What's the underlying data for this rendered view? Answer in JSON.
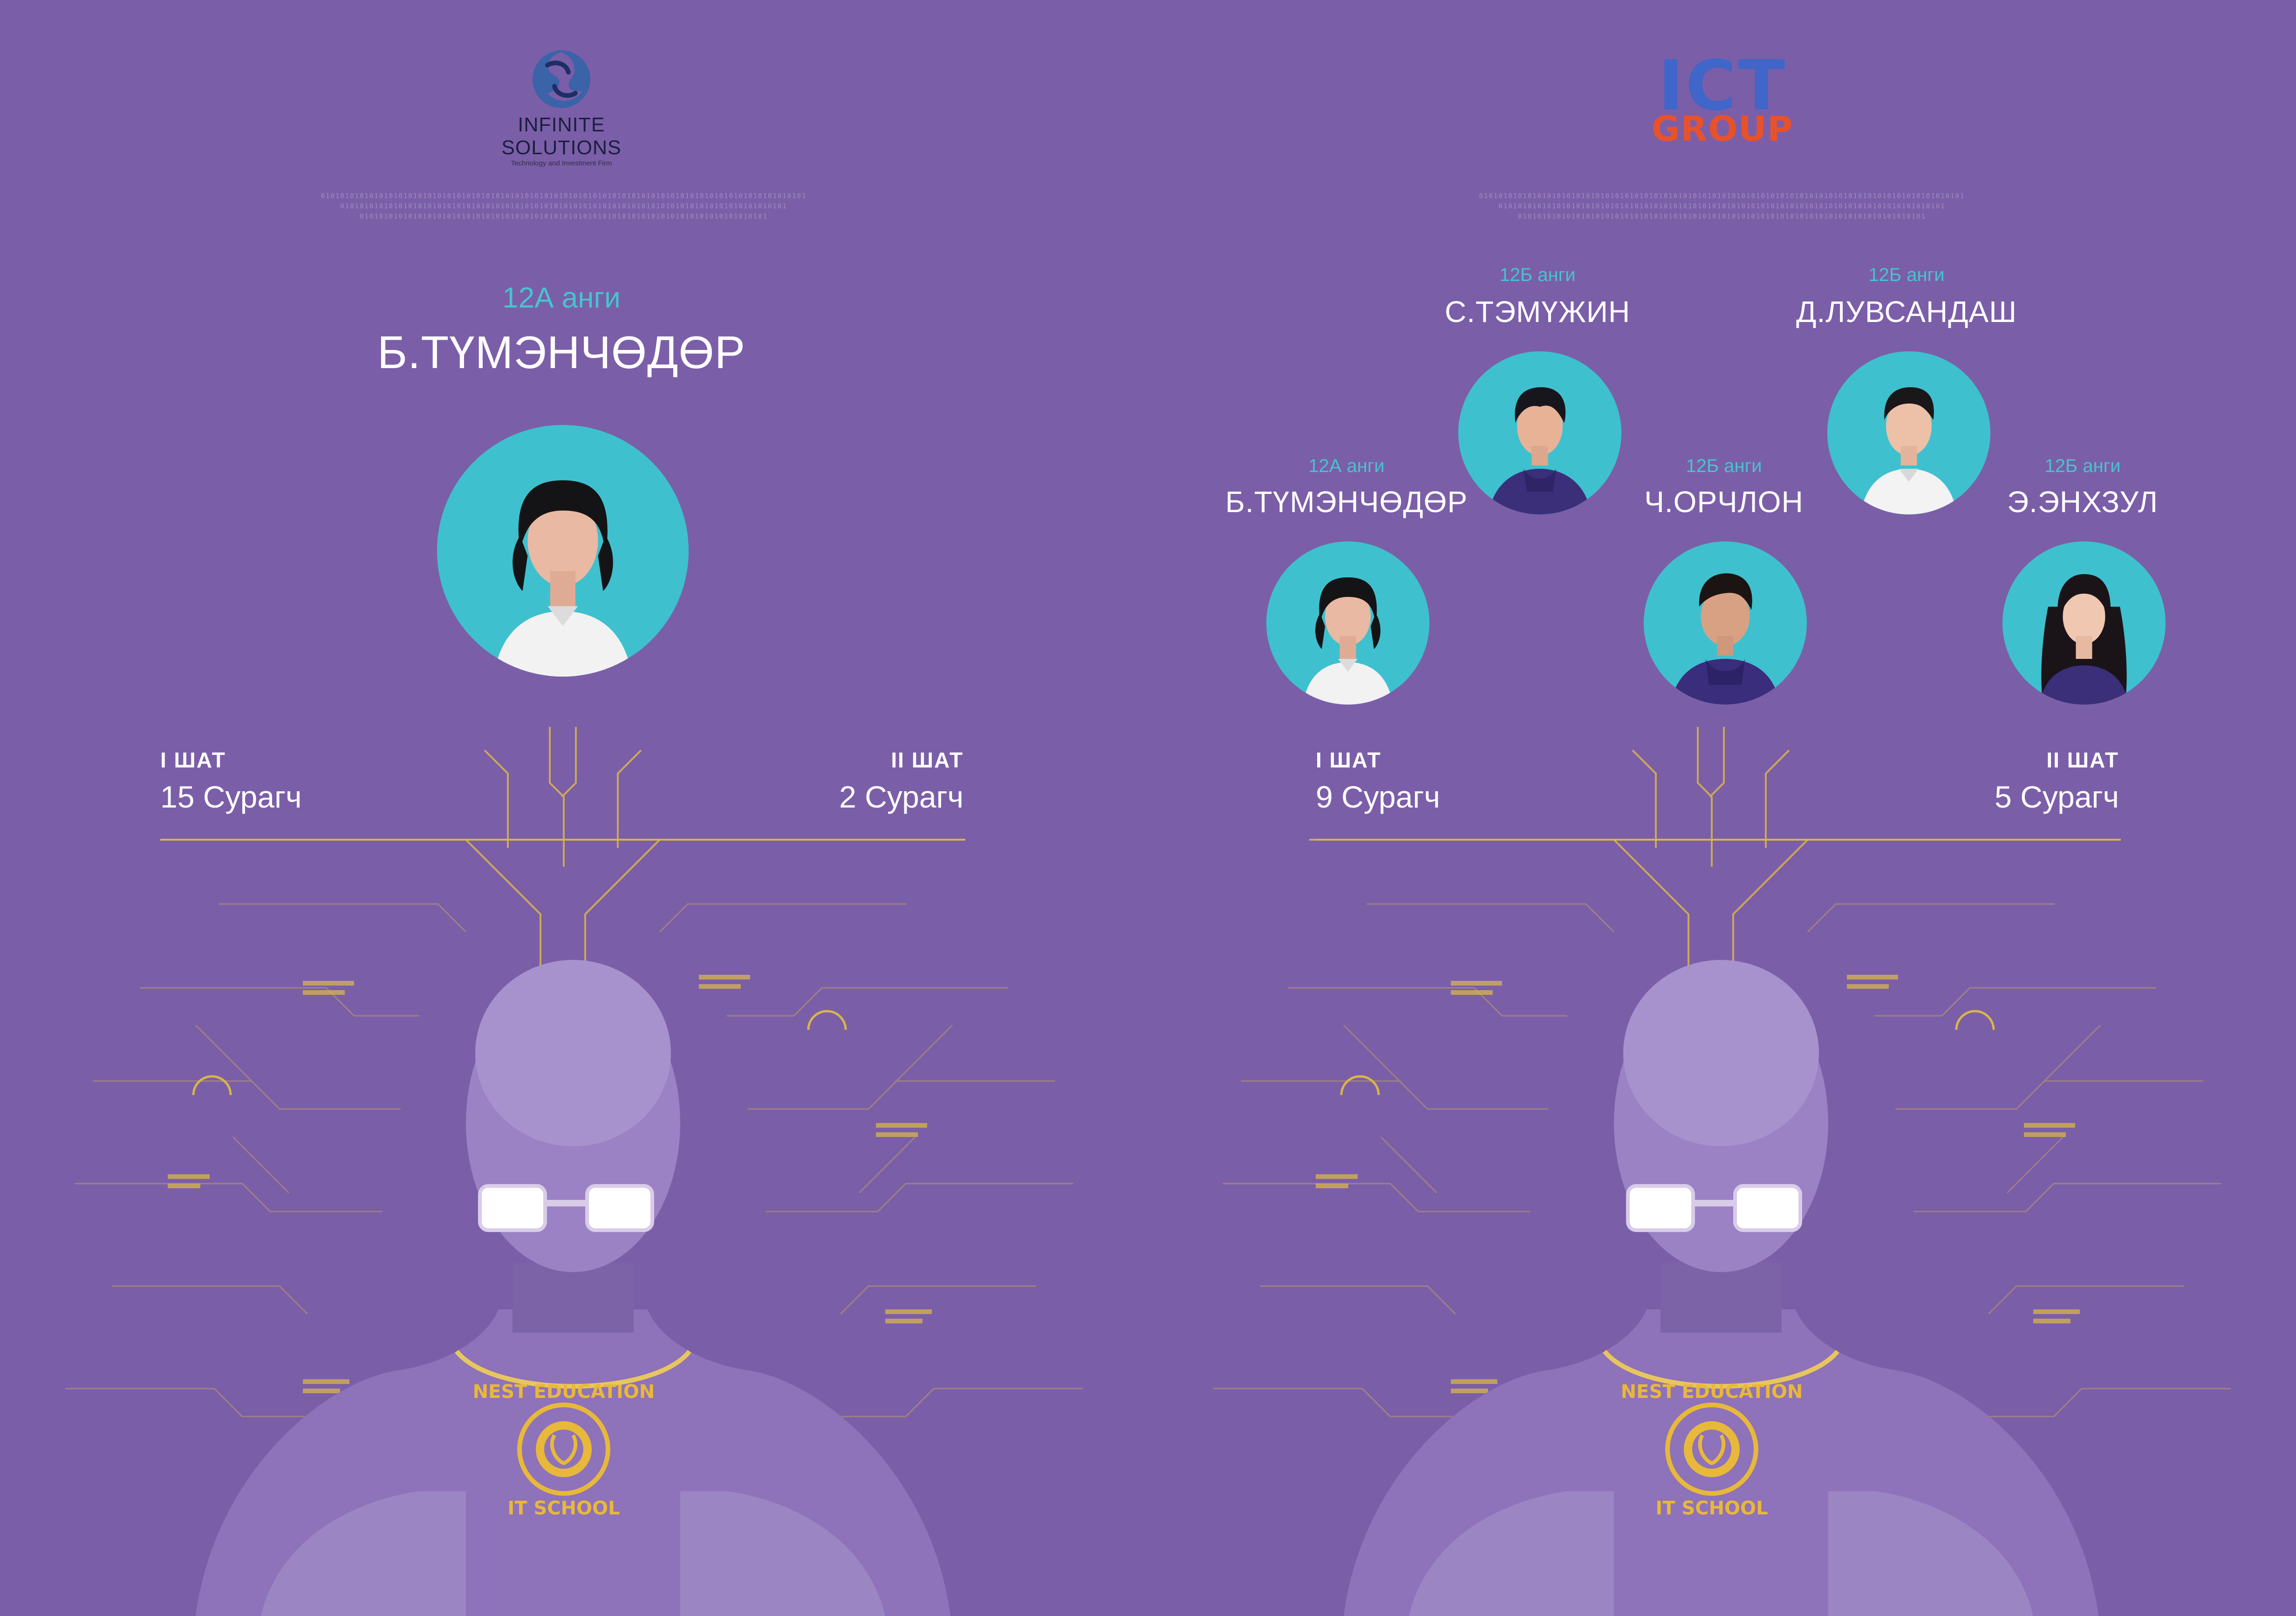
{
  "left": {
    "logo": {
      "name": "INFINITE SOLUTIONS",
      "tagline": "Technology and Investment Firm"
    },
    "binary": [
      "0101010101010101010101010101010101010101010101010101010101010101010101010101010101010101010101010101",
      "01010101010101010101010101010101010101010101010101010101010101010101010101010101010101010101",
      "010101010101010101010101010101010101010101010101010101010101010101010101010101010101"
    ],
    "student": {
      "class": "12А анги",
      "name": "Б.ТҮМЭНЧӨДӨР"
    },
    "stage1": {
      "title": "I ШАТ",
      "count": "15 Сурагч"
    },
    "stage2": {
      "title": "II ШАТ",
      "count": "2 Сурагч"
    },
    "badge": {
      "line1": "NEST EDUCATION",
      "line2": "IT SCHOOL"
    }
  },
  "right": {
    "logo": {
      "line1": "ICT",
      "line2": "GROUP"
    },
    "binary": [
      "0101010101010101010101010101010101010101010101010101010101010101010101010101010101010101010101010101",
      "01010101010101010101010101010101010101010101010101010101010101010101010101010101010101010101",
      "010101010101010101010101010101010101010101010101010101010101010101010101010101010101"
    ],
    "students": [
      {
        "class": "12Б анги",
        "name": "С.ТЭМҮЖИН"
      },
      {
        "class": "12Б анги",
        "name": "Д.ЛУВСАНДАШ"
      },
      {
        "class": "12А анги",
        "name": "Б.ТҮМЭНЧӨДӨР"
      },
      {
        "class": "12Б анги",
        "name": "Ч.ОРЧЛОН"
      },
      {
        "class": "12Б анги",
        "name": "Э.ЭНХЗУЛ"
      }
    ],
    "stage1": {
      "title": "I ШАТ",
      "count": "9 Сурагч"
    },
    "stage2": {
      "title": "II ШАТ",
      "count": "5 Сурагч"
    },
    "badge": {
      "line1": "NEST EDUCATION",
      "line2": "IT SCHOOL"
    }
  },
  "colors": {
    "background": "#7b5ea8",
    "accent_cyan": "#47c3d0",
    "circuit_gold": "#d8b64a",
    "ict_blue": "#3f66c8",
    "ict_orange": "#e8522a"
  }
}
